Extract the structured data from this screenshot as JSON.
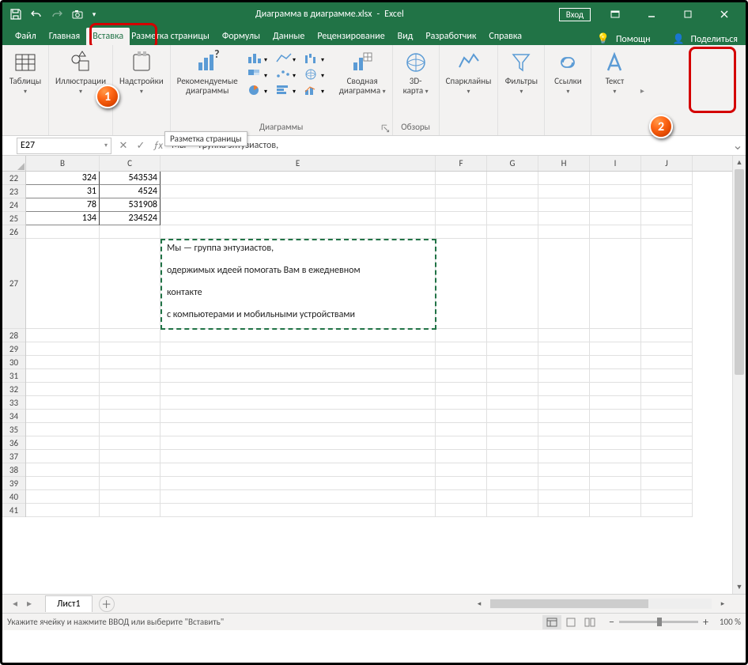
{
  "title": {
    "file": "Диаграмма в диаграмме.xlsx",
    "app": "Excel"
  },
  "login": "Вход",
  "tabs": {
    "file": "Файл",
    "home": "Главная",
    "insert": "Вставка",
    "layout": "Разметка страницы",
    "formulas": "Формулы",
    "data": "Данные",
    "review": "Рецензирование",
    "view": "Вид",
    "dev": "Разработчик",
    "help": "Справка",
    "tellme": "Помощн",
    "share": "Поделиться"
  },
  "ribbon": {
    "tables": "Таблицы",
    "illustrations": "Иллюстрации",
    "addins": "Надстройки",
    "recommended_charts": "Рекомендуемые\nдиаграммы",
    "charts_group": "Диаграммы",
    "pivot_chart": "Сводная\nдиаграмма",
    "map3d": "3D-\nкарта",
    "tours": "Обзоры",
    "sparklines": "Спарклайны",
    "filters": "Фильтры",
    "links": "Ссылки",
    "text": "Текст"
  },
  "tooltip": "Разметка страницы",
  "namebox": "E27",
  "formula_bar": "Мы — группа энтузиастов,",
  "columns": [
    "B",
    "C",
    "E",
    "F",
    "G",
    "H",
    "I",
    "J"
  ],
  "rows": [
    {
      "n": 22,
      "B": "324",
      "C": "543534"
    },
    {
      "n": 23,
      "B": "31",
      "C": "4524"
    },
    {
      "n": 24,
      "B": "78",
      "C": "531908"
    },
    {
      "n": 25,
      "B": "134",
      "C": "234524"
    }
  ],
  "extra_rows": [
    26,
    27,
    28,
    29,
    30,
    31,
    32,
    33,
    34,
    35,
    36,
    37,
    38,
    39,
    40,
    41
  ],
  "textbox": "Мы — группа энтузиастов,\n\nодержимых идеей помогать Вам в ежедневном\n\nконтакте\n\nс компьютерами и мобильными устройствами",
  "sheet": "Лист1",
  "status": "Укажите ячейку и нажмите ВВОД или выберите \"Вставить\"",
  "zoom": "100 %",
  "callouts": {
    "c1": "1",
    "c2": "2"
  }
}
